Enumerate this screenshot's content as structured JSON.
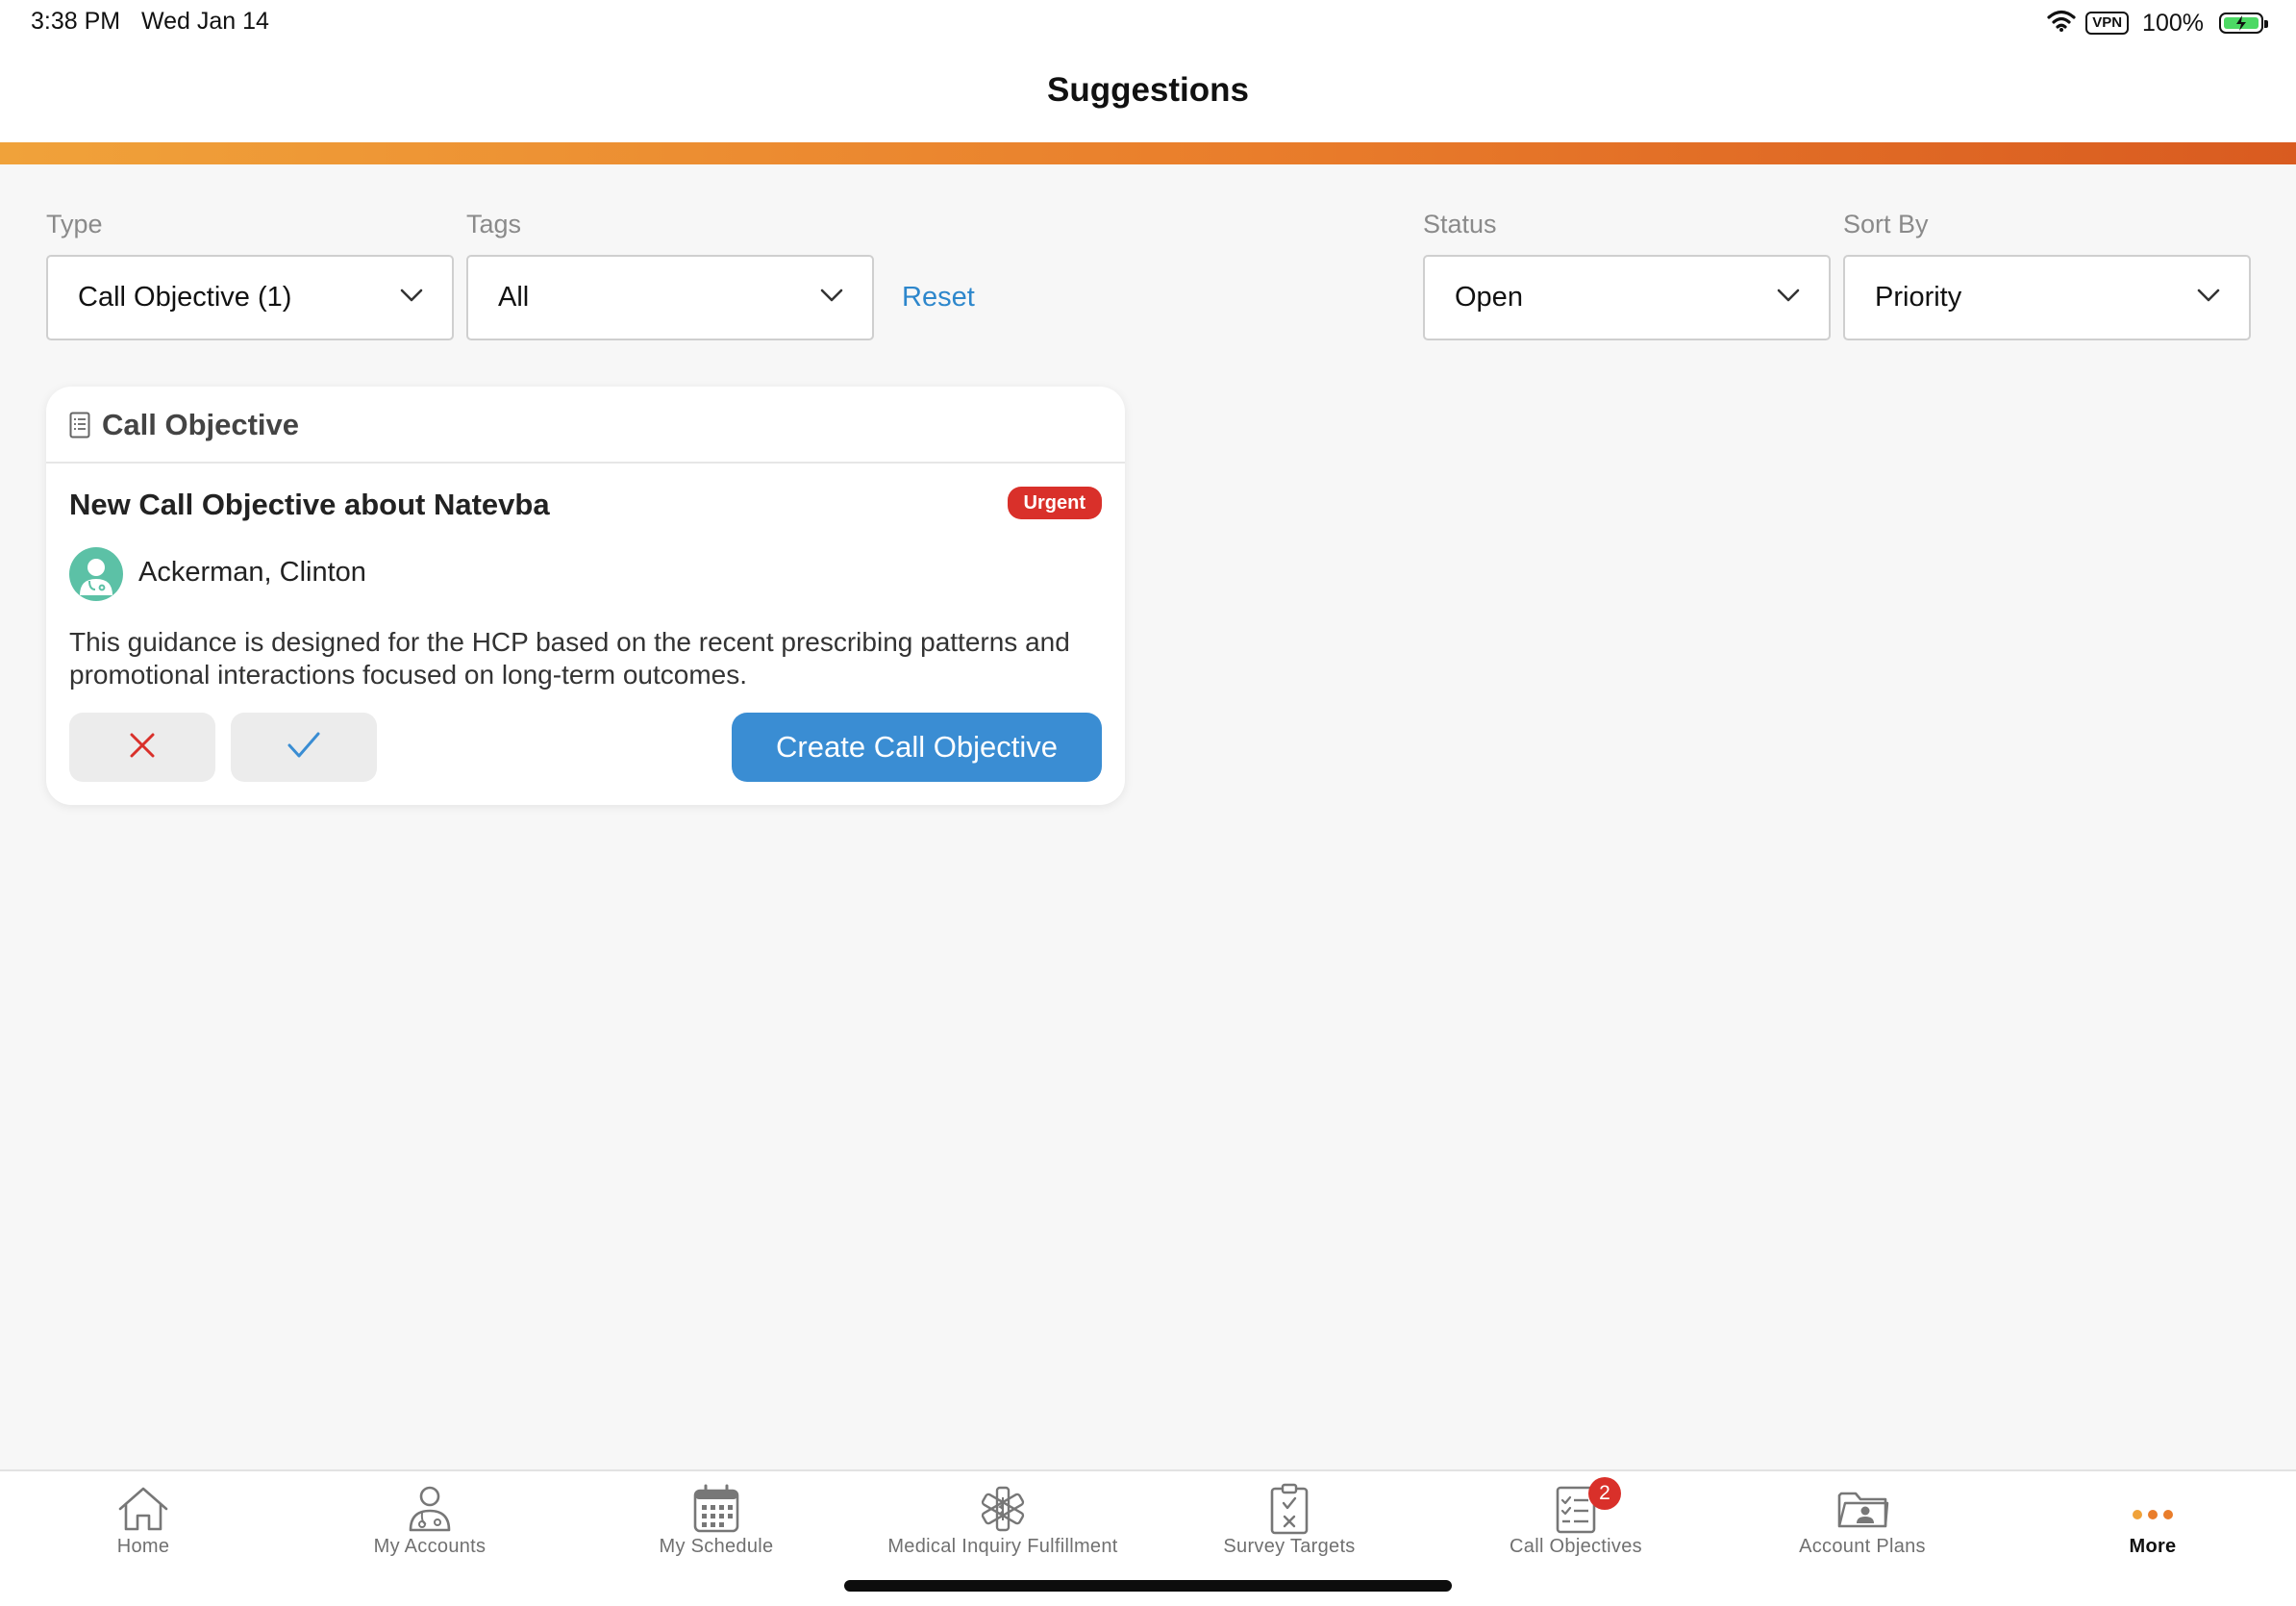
{
  "status_bar": {
    "time": "3:38 PM",
    "date": "Wed Jan 14",
    "vpn": "VPN",
    "battery": "100%"
  },
  "header": {
    "title": "Suggestions"
  },
  "colors": {
    "accent_start": "#f0a23a",
    "accent_end": "#d95b20",
    "link": "#2d87cc",
    "primary": "#3a8dd3",
    "urgent": "#d9302a"
  },
  "filters": {
    "type": {
      "label": "Type",
      "value": "Call Objective (1)"
    },
    "tags": {
      "label": "Tags",
      "value": "All"
    },
    "reset": "Reset",
    "status": {
      "label": "Status",
      "value": "Open"
    },
    "sort": {
      "label": "Sort By",
      "value": "Priority"
    }
  },
  "card": {
    "type_label": "Call Objective",
    "title": "New Call Objective about Natevba",
    "badge": "Urgent",
    "person": "Ackerman, Clinton",
    "description": "This guidance is designed for the HCP based on the recent prescribing patterns and promotional interactions focused on long-term outcomes.",
    "action_label": "Create Call Objective",
    "dismiss_icon": "close-icon",
    "accept_icon": "check-icon"
  },
  "tabs": [
    {
      "label": "Home",
      "icon": "home-icon"
    },
    {
      "label": "My Accounts",
      "icon": "doctor-icon"
    },
    {
      "label": "My Schedule",
      "icon": "calendar-icon"
    },
    {
      "label": "Medical Inquiry Fulfillment",
      "icon": "medical-star-icon"
    },
    {
      "label": "Survey Targets",
      "icon": "clipboard-icon"
    },
    {
      "label": "Call Objectives",
      "icon": "checklist-icon",
      "badge": "2"
    },
    {
      "label": "Account Plans",
      "icon": "folder-icon"
    },
    {
      "label": "More",
      "icon": "more-dots-icon",
      "active": true
    }
  ]
}
